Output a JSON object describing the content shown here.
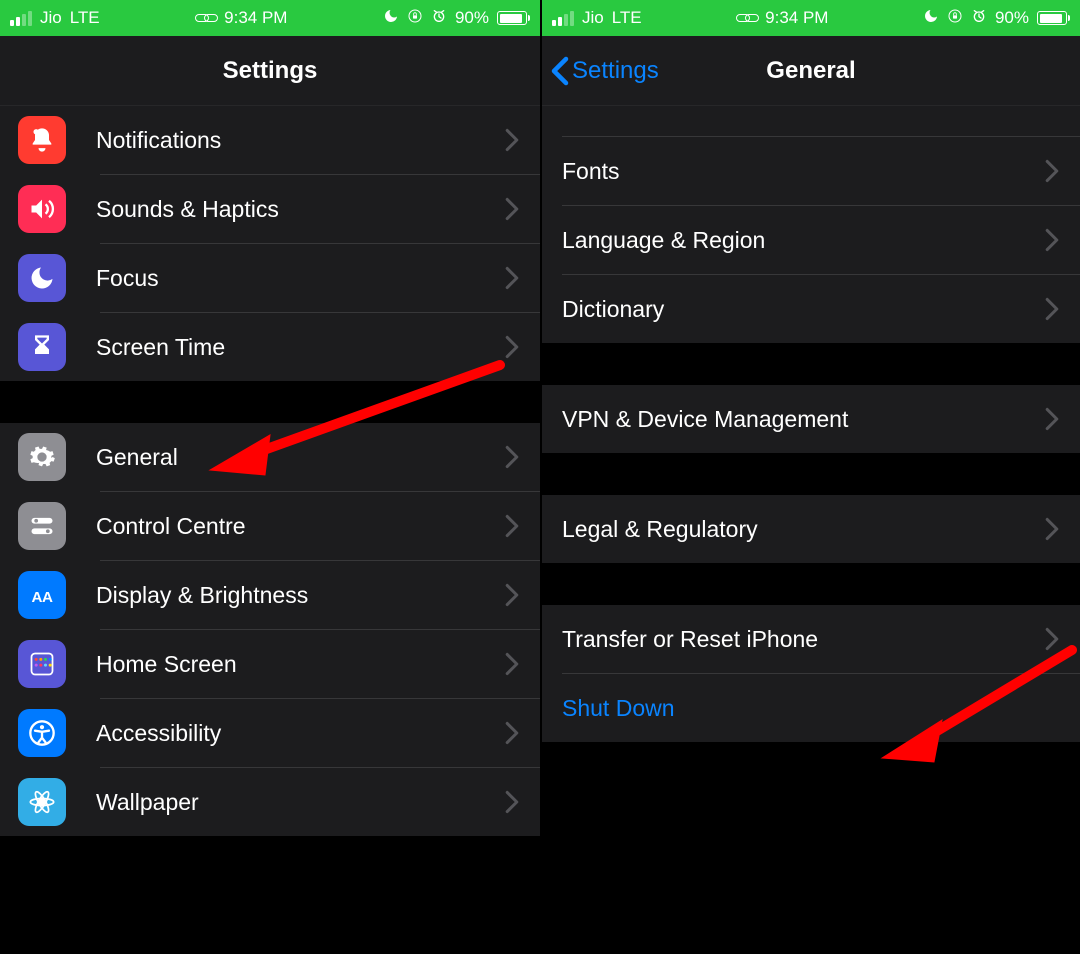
{
  "status": {
    "carrier": "Jio",
    "network": "LTE",
    "time": "9:34 PM",
    "battery_pct": "90%",
    "battery_fill": 90
  },
  "left": {
    "title": "Settings",
    "group1": [
      {
        "label": "Notifications",
        "name": "settings-item-notifications"
      },
      {
        "label": "Sounds & Haptics",
        "name": "settings-item-sounds"
      },
      {
        "label": "Focus",
        "name": "settings-item-focus"
      },
      {
        "label": "Screen Time",
        "name": "settings-item-screentime"
      }
    ],
    "group2": [
      {
        "label": "General",
        "name": "settings-item-general"
      },
      {
        "label": "Control Centre",
        "name": "settings-item-controlcentre"
      },
      {
        "label": "Display & Brightness",
        "name": "settings-item-display"
      },
      {
        "label": "Home Screen",
        "name": "settings-item-homescreen"
      },
      {
        "label": "Accessibility",
        "name": "settings-item-accessibility"
      },
      {
        "label": "Wallpaper",
        "name": "settings-item-wallpaper"
      }
    ]
  },
  "right": {
    "back_label": "Settings",
    "title": "General",
    "group1": [
      {
        "label": "Fonts",
        "name": "general-item-fonts"
      },
      {
        "label": "Language & Region",
        "name": "general-item-language"
      },
      {
        "label": "Dictionary",
        "name": "general-item-dictionary"
      }
    ],
    "group2": [
      {
        "label": "VPN & Device Management",
        "name": "general-item-vpn"
      }
    ],
    "group3": [
      {
        "label": "Legal & Regulatory",
        "name": "general-item-legal"
      }
    ],
    "group4": [
      {
        "label": "Transfer or Reset iPhone",
        "name": "general-item-reset"
      },
      {
        "label": "Shut Down",
        "name": "general-item-shutdown"
      }
    ]
  }
}
